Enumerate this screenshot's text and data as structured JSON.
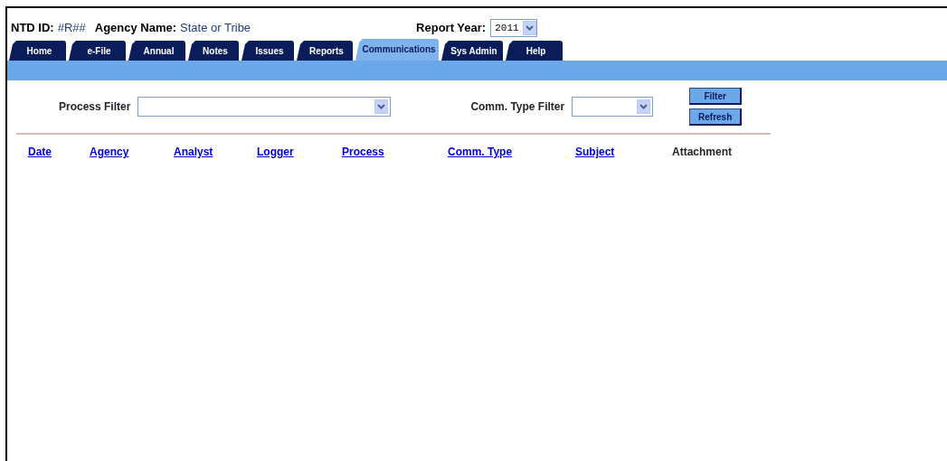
{
  "header": {
    "ntd_id_label": "NTD ID:",
    "ntd_id": "#R##",
    "agency_label": "Agency Name:",
    "agency": "State or Tribe",
    "report_year_label": "Report Year:",
    "report_year": "2011"
  },
  "tabs": [
    {
      "label": "Home",
      "selected": false
    },
    {
      "label": "e-File",
      "selected": false
    },
    {
      "label": "Annual",
      "selected": false
    },
    {
      "label": "Notes",
      "selected": false
    },
    {
      "label": "Issues",
      "selected": false
    },
    {
      "label": "Reports",
      "selected": false
    },
    {
      "label": "Communications",
      "selected": true
    },
    {
      "label": "Sys Admin",
      "selected": false
    },
    {
      "label": "Help",
      "selected": false
    }
  ],
  "filters": [
    {
      "label": "Process Filter",
      "kind": "wide"
    },
    {
      "label": "Comm. Type Filter",
      "kind": "narrow"
    }
  ],
  "buttons": [
    "Filter",
    "Refresh"
  ],
  "columns": [
    {
      "label": "Date",
      "kind": "link"
    },
    {
      "label": "Agency",
      "kind": "link"
    },
    {
      "label": "Analyst",
      "kind": "link"
    },
    {
      "label": "Logger",
      "kind": "link"
    },
    {
      "label": "Process",
      "kind": "link"
    },
    {
      "label": "Comm. Type",
      "kind": "link"
    },
    {
      "label": "Subject",
      "kind": "link"
    },
    {
      "label": "Attachment",
      "kind": "plain"
    }
  ]
}
